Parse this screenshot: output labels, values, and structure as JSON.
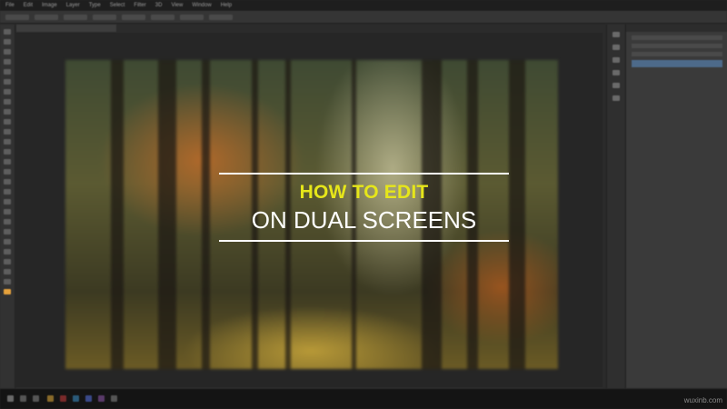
{
  "app": {
    "menu": [
      "File",
      "Edit",
      "Image",
      "Layer",
      "Type",
      "Select",
      "Filter",
      "3D",
      "View",
      "Window",
      "Help"
    ]
  },
  "overlay": {
    "line1": "HOW TO EDIT",
    "line2": "ON DUAL SCREENS",
    "line1_color": "#e6e61a",
    "line2_color": "#ffffff"
  },
  "watermark": "wuxinb.com",
  "icons": {
    "tools": "tool-icon",
    "panel": "panel-icon",
    "taskbar": "taskbar-app-icon"
  }
}
